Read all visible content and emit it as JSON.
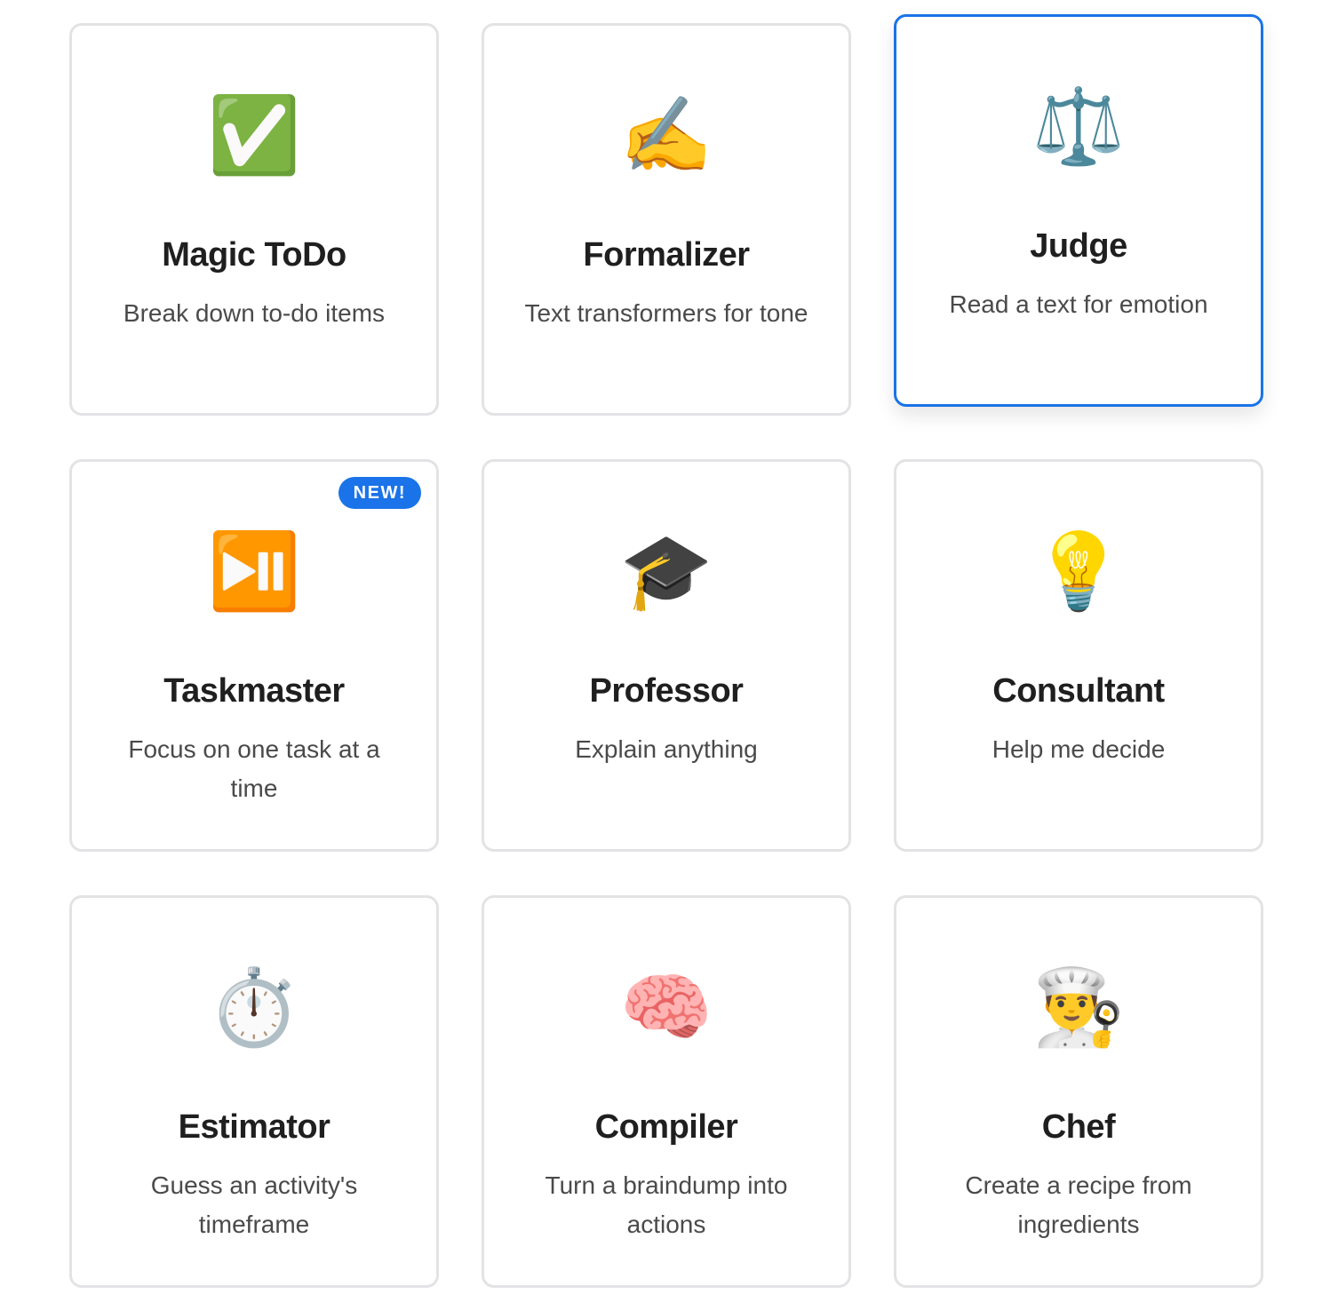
{
  "cards": [
    {
      "emoji": "✅",
      "icon": "check-mark-button-icon",
      "title": "Magic ToDo",
      "description": "Break down to-do items"
    },
    {
      "emoji": "✍️",
      "icon": "writing-hand-icon",
      "title": "Formalizer",
      "description": "Text transformers for tone"
    },
    {
      "emoji": "⚖️",
      "icon": "balance-scale-icon",
      "title": "Judge",
      "description": "Read a text for emotion",
      "selected": true
    },
    {
      "emoji": "⏯️",
      "icon": "play-pause-icon",
      "title": "Taskmaster",
      "description": "Focus on one task at a time",
      "badge": "NEW!"
    },
    {
      "emoji": "🎓",
      "icon": "graduation-cap-icon",
      "title": "Professor",
      "description": "Explain anything"
    },
    {
      "emoji": "💡",
      "icon": "light-bulb-icon",
      "title": "Consultant",
      "description": "Help me decide"
    },
    {
      "emoji": "⏱️",
      "icon": "stopwatch-icon",
      "title": "Estimator",
      "description": "Guess an activity's timeframe"
    },
    {
      "emoji": "🧠",
      "icon": "brain-icon",
      "title": "Compiler",
      "description": "Turn a braindump into actions"
    },
    {
      "emoji": "👨‍🍳",
      "icon": "chef-icon",
      "title": "Chef",
      "description": "Create a recipe from ingredients"
    }
  ],
  "colors": {
    "accent": "#1a73e8",
    "card_border": "#e3e3e6",
    "title_text": "#1f1f1f",
    "description_text": "#4a4a4a"
  }
}
